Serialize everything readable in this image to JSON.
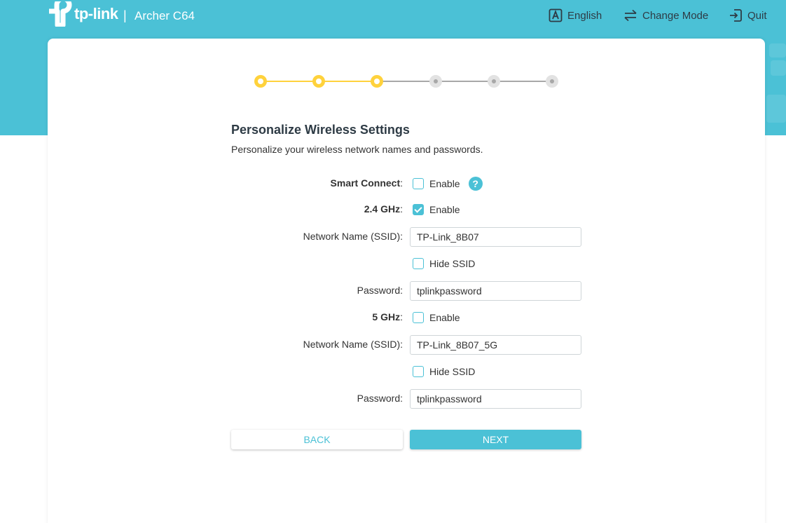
{
  "header": {
    "brand": "tp-link",
    "separator": "|",
    "model": "Archer C64",
    "language_label": "English",
    "change_mode_label": "Change Mode",
    "quit_label": "Quit"
  },
  "wizard": {
    "total_steps": 6,
    "completed_steps": 3,
    "accent_color": "#ffd23c",
    "title": "Personalize Wireless Settings",
    "subtitle": "Personalize your wireless network names and passwords."
  },
  "form": {
    "smart_connect": {
      "label": "Smart Connect",
      "colon": ":",
      "checkbox_label": "Enable",
      "checked": false,
      "help_glyph": "?"
    },
    "band_24": {
      "label": "2.4 GHz",
      "colon": ":",
      "checkbox_label": "Enable",
      "checked": true,
      "ssid_label": "Network Name (SSID):",
      "ssid_value": "TP-Link_8B07",
      "hide_ssid_label": "Hide SSID",
      "hide_ssid_checked": false,
      "password_label": "Password:",
      "password_value": "tplinkpassword"
    },
    "band_5": {
      "label": "5 GHz",
      "colon": ":",
      "checkbox_label": "Enable",
      "checked": false,
      "ssid_label": "Network Name (SSID):",
      "ssid_value": "TP-Link_8B07_5G",
      "hide_ssid_label": "Hide SSID",
      "hide_ssid_checked": false,
      "password_label": "Password:",
      "password_value": "tplinkpassword"
    }
  },
  "buttons": {
    "back_label": "BACK",
    "next_label": "NEXT"
  },
  "colors": {
    "primary": "#4bc1d6",
    "text_dark": "#2e3b45"
  },
  "icons": {
    "logo": "tp-link-logo-icon",
    "language": "language-a-icon",
    "change_mode": "swap-arrows-icon",
    "quit": "exit-icon",
    "help": "help-question-icon"
  }
}
